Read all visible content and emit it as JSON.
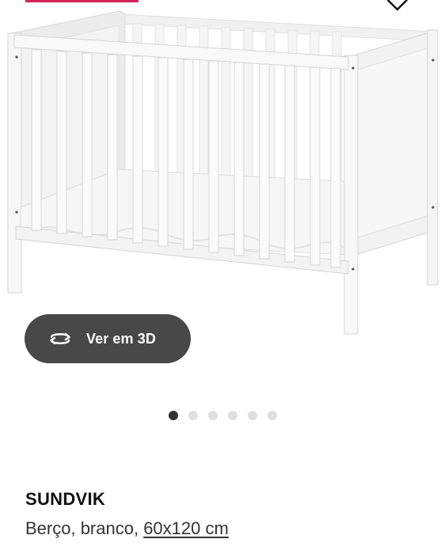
{
  "product": {
    "name": "SUNDVIK",
    "description": "Berço, branco,",
    "size_link": "60x120 cm"
  },
  "gallery": {
    "view_3d_label": "Ver em 3D",
    "slide_count": 6,
    "active_slide": 1
  },
  "icons": {
    "wishlist": "heart-icon",
    "rotate_3d": "rotate-3d-icon"
  },
  "colors": {
    "accent": "#d3245a",
    "button_bg": "#484848",
    "dot_active": "#333333",
    "dot_inactive": "#dfdfdf"
  }
}
